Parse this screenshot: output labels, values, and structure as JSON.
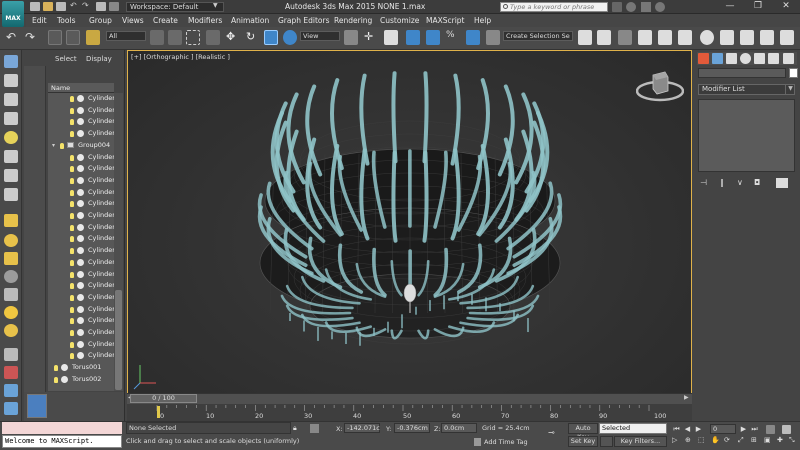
{
  "window": {
    "app_logo_text": "MAX",
    "title": "Autodesk 3ds Max  2015      NONE 1.max",
    "workspace": "Workspace: Default",
    "search_placeholder": "Type a keyword or phrase",
    "min_symbol": "—",
    "max_symbol": "❐",
    "close_symbol": "✕"
  },
  "menu": [
    "Edit",
    "Tools",
    "Group",
    "Views",
    "Create",
    "Modifiers",
    "Animation",
    "Graph Editors",
    "Rendering",
    "Customize",
    "MAXScript",
    "Help"
  ],
  "toolbar": {
    "selection_filter": "All",
    "reference_coord": "View",
    "named_selection": "Create Selection Se"
  },
  "explorer": {
    "tabs": [
      "Select",
      "Display"
    ],
    "column_header": "Name",
    "rows": [
      {
        "label": "Cylinder",
        "indent": 2,
        "type": "obj"
      },
      {
        "label": "Cylinder",
        "indent": 2,
        "type": "obj"
      },
      {
        "label": "Cylinder",
        "indent": 2,
        "type": "obj"
      },
      {
        "label": "Cylinder",
        "indent": 2,
        "type": "obj"
      },
      {
        "label": "Group004",
        "indent": 1,
        "type": "grp"
      },
      {
        "label": "Cylinder",
        "indent": 2,
        "type": "obj"
      },
      {
        "label": "Cylinder",
        "indent": 2,
        "type": "obj"
      },
      {
        "label": "Cylinder",
        "indent": 2,
        "type": "obj"
      },
      {
        "label": "Cylinder",
        "indent": 2,
        "type": "obj"
      },
      {
        "label": "Cylinder",
        "indent": 2,
        "type": "obj"
      },
      {
        "label": "Cylinder",
        "indent": 2,
        "type": "obj"
      },
      {
        "label": "Cylinder",
        "indent": 2,
        "type": "obj"
      },
      {
        "label": "Cylinder",
        "indent": 2,
        "type": "obj"
      },
      {
        "label": "Cylinder",
        "indent": 2,
        "type": "obj"
      },
      {
        "label": "Cylinder",
        "indent": 2,
        "type": "obj"
      },
      {
        "label": "Cylinder",
        "indent": 2,
        "type": "obj"
      },
      {
        "label": "Cylinder",
        "indent": 2,
        "type": "obj"
      },
      {
        "label": "Cylinder",
        "indent": 2,
        "type": "obj"
      },
      {
        "label": "Cylinder",
        "indent": 2,
        "type": "obj"
      },
      {
        "label": "Cylinder",
        "indent": 2,
        "type": "obj"
      },
      {
        "label": "Cylinder",
        "indent": 2,
        "type": "obj"
      },
      {
        "label": "Cylinder",
        "indent": 2,
        "type": "obj"
      },
      {
        "label": "Cylinder",
        "indent": 2,
        "type": "obj"
      },
      {
        "label": "Torus001",
        "indent": 0,
        "type": "obj"
      },
      {
        "label": "Torus002",
        "indent": 0,
        "type": "obj"
      }
    ]
  },
  "viewport": {
    "label": "[+] [Orthographic ] [Realistic ]",
    "border_color": "#e0b24a",
    "model_color": "#8fc3c8"
  },
  "command_panel": {
    "modifier_list": "Modifier List"
  },
  "timeline": {
    "frame_display": "0 / 100",
    "tick_labels": [
      "0",
      "10",
      "20",
      "30",
      "40",
      "50",
      "60",
      "70",
      "80",
      "90",
      "100"
    ]
  },
  "status": {
    "maxscript_output": "Welcome to MAXScript.",
    "selection": "None Selected",
    "prompt": "Click and drag to select and scale objects (uniformly)",
    "x_label": "X:",
    "x_value": "-142.071c",
    "y_label": "Y:",
    "y_value": "-0.376cm",
    "z_label": "Z:",
    "z_value": "0.0cm",
    "grid": "Grid = 25.4cm",
    "time_tag": "Add Time Tag",
    "auto_key": "Auto Key",
    "set_key": "Set Key",
    "key_selection": "Selected",
    "key_filters": "Key Filters...",
    "current_frame": "0"
  }
}
